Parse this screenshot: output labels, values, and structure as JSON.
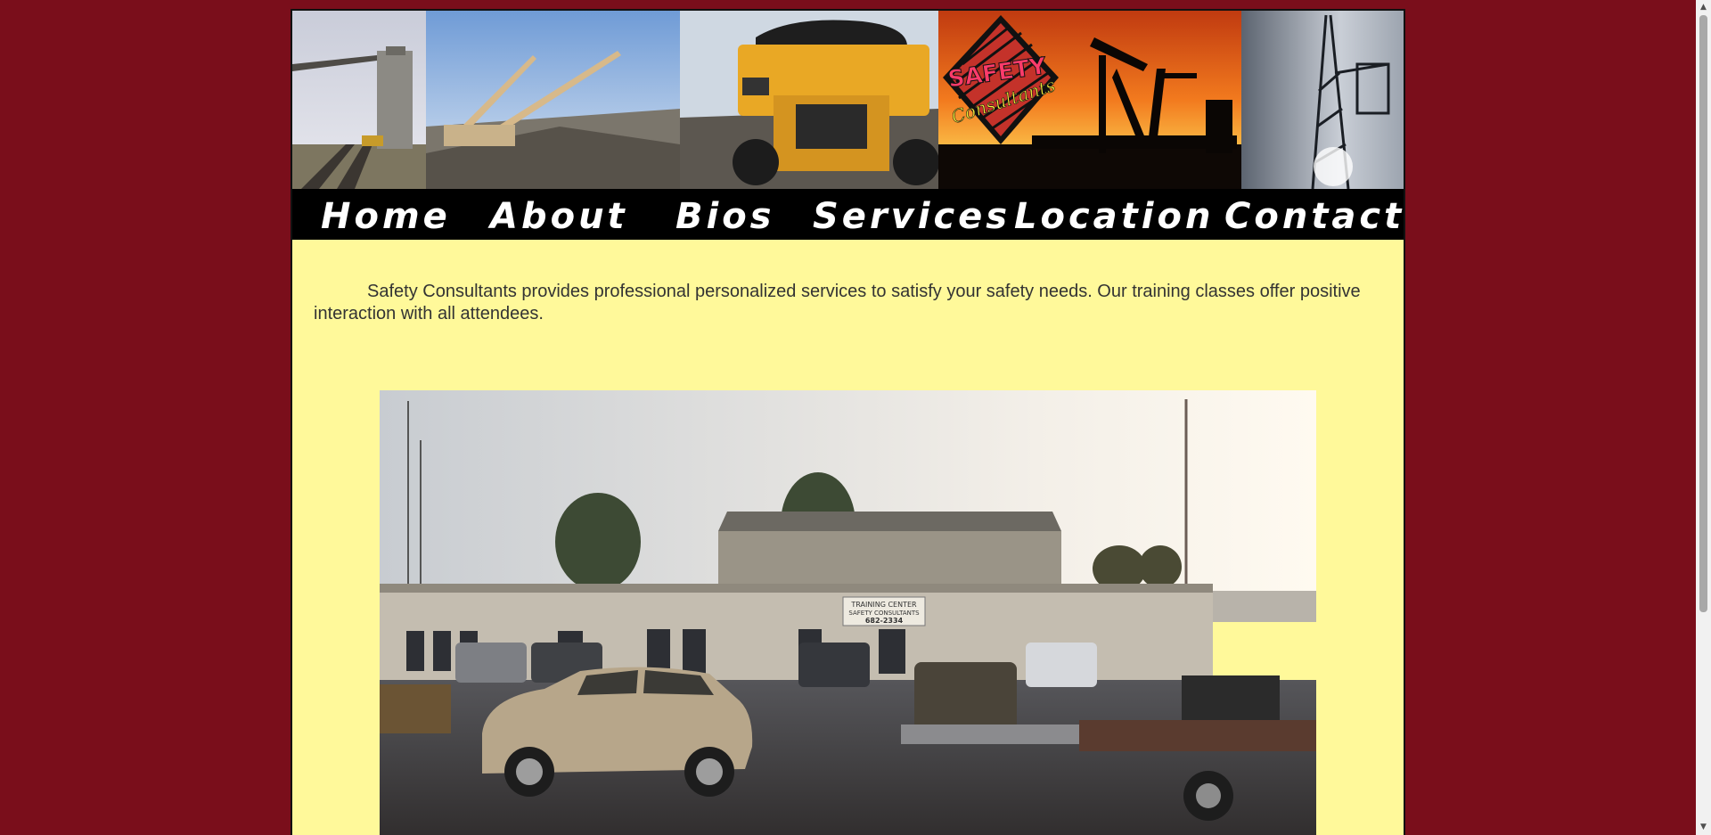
{
  "banner": {
    "logo_text_top": "SAFETY",
    "logo_text_bottom": "Consultants"
  },
  "nav": {
    "items": [
      {
        "label": "Home"
      },
      {
        "label": "About"
      },
      {
        "label": "Bios"
      },
      {
        "label": "Services"
      },
      {
        "label": "Location"
      },
      {
        "label": "Contact"
      }
    ]
  },
  "main": {
    "intro": "Safety Consultants provides professional personalized services to satisfy your safety needs. Our training classes offer positive interaction with all attendees."
  },
  "photo": {
    "sign_line1": "TRAINING CENTER",
    "sign_line2": "SAFETY CONSULTANTS",
    "sign_line3": "682-2334"
  },
  "colors": {
    "background": "#7a0e1b",
    "content": "#fff99a",
    "nav": "#000000"
  },
  "scrollbar": {
    "up_icon": "triangle-up-icon",
    "down_icon": "triangle-down-icon"
  }
}
